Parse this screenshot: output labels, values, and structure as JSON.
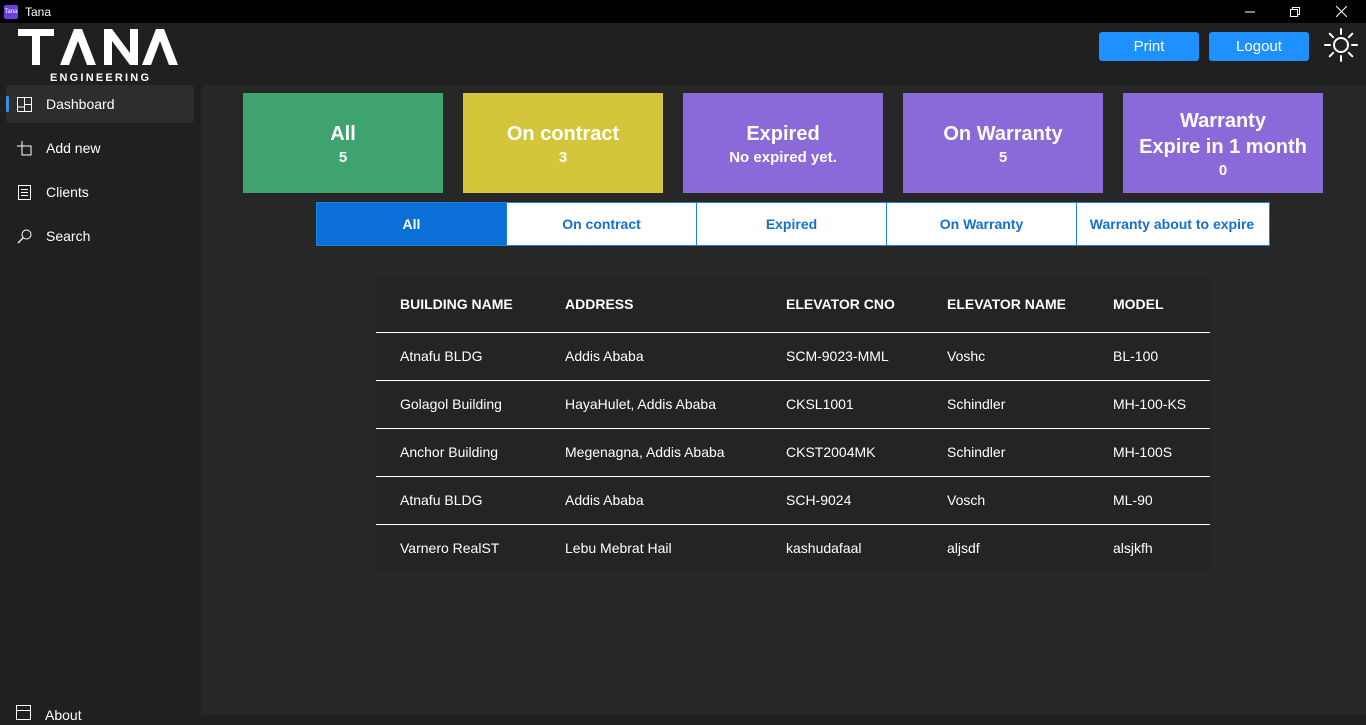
{
  "window": {
    "title": "Tana",
    "icon_text": "Tana"
  },
  "brand": {
    "name": "TANA",
    "subtitle": "ENGINEERING"
  },
  "header": {
    "print_label": "Print",
    "logout_label": "Logout"
  },
  "sidebar": {
    "items": [
      {
        "label": "Dashboard",
        "icon": "dashboard-icon"
      },
      {
        "label": "Add new",
        "icon": "add-icon"
      },
      {
        "label": "Clients",
        "icon": "clients-icon"
      },
      {
        "label": "Search",
        "icon": "search-icon"
      }
    ],
    "about_label": "About"
  },
  "cards": [
    {
      "title": "All",
      "value": "5",
      "color": "#3fa36f"
    },
    {
      "title": "On contract",
      "value": "3",
      "color": "#d3c63b"
    },
    {
      "title": "Expired",
      "value": "No expired yet.",
      "color": "#8a6ad8"
    },
    {
      "title": "On Warranty",
      "value": "5",
      "color": "#8a6ad8"
    },
    {
      "title": "Warranty\nExpire in 1 month",
      "value": "0",
      "color": "#8a6ad8"
    }
  ],
  "tabs": [
    "All",
    "On contract",
    "Expired",
    "On Warranty",
    "Warranty about to expire"
  ],
  "table": {
    "headers": [
      "BUILDING NAME",
      "ADDRESS",
      "ELEVATOR CNO",
      "ELEVATOR NAME",
      "MODEL"
    ],
    "rows": [
      [
        "Atnafu BLDG",
        "Addis Ababa",
        "SCM-9023-MML",
        "Voshc",
        "BL-100"
      ],
      [
        "Golagol Building",
        "HayaHulet, Addis Ababa",
        "CKSL1001",
        "Schindler",
        "MH-100-KS"
      ],
      [
        "Anchor Building",
        "Megenagna, Addis Ababa",
        "CKST2004MK",
        "Schindler",
        "MH-100S"
      ],
      [
        "Atnafu BLDG",
        "Addis Ababa",
        "SCH-9024",
        "Vosch",
        "ML-90"
      ],
      [
        "Varnero RealST",
        "Lebu Mebrat Hail",
        "kashudafaal",
        "aljsdf",
        "alsjkfh"
      ]
    ]
  },
  "colors": {
    "accent": "#1e90ff",
    "tab_border": "#1e80e0"
  }
}
